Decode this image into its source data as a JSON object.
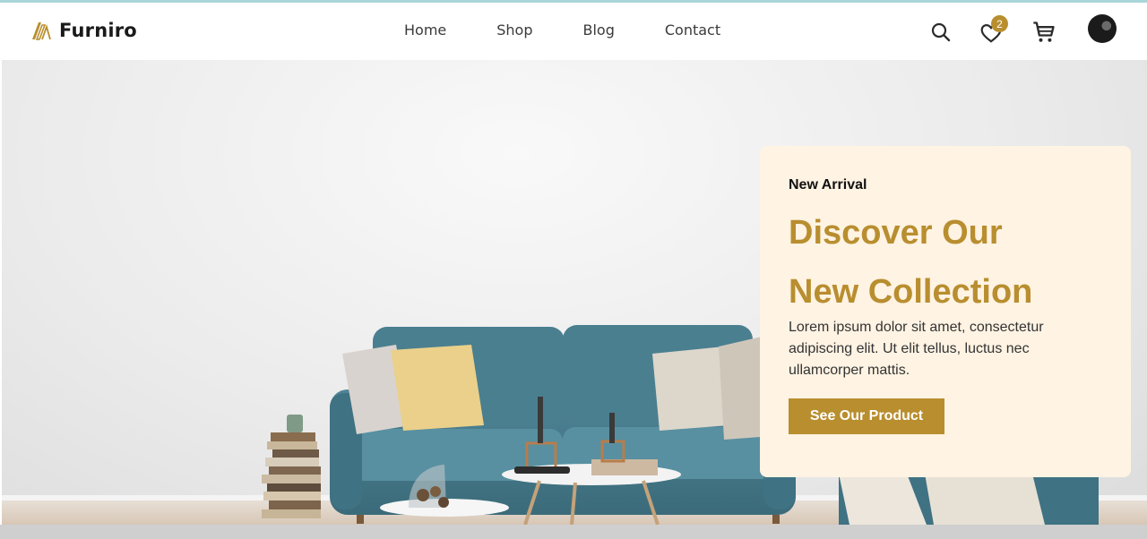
{
  "brand": {
    "name": "Furniro",
    "accent": "#b88e2f"
  },
  "nav": {
    "links": [
      {
        "label": "Home"
      },
      {
        "label": "Shop"
      },
      {
        "label": "Blog"
      },
      {
        "label": "Contact"
      }
    ]
  },
  "actions": {
    "search_icon": "search-icon",
    "wishlist_icon": "heart-icon",
    "wishlist_count": "2",
    "cart_icon": "cart-icon",
    "profile": "avatar"
  },
  "hero": {
    "eyebrow": "New Arrival",
    "title_line1": "Discover Our",
    "title_line2": "New Collection",
    "description": "Lorem ipsum dolor sit amet, consectetur adipiscing elit. Ut elit tellus, luctus nec ullamcorper mattis.",
    "button_label": "See Our Product"
  },
  "colors": {
    "card_background": "#fff3e3",
    "badge": "#b88e2f",
    "top_strip": "#a9d6d8"
  }
}
